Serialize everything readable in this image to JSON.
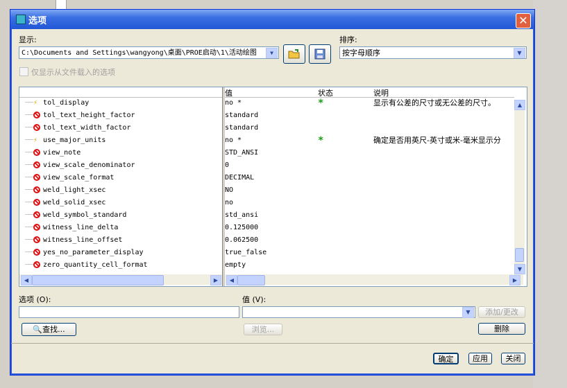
{
  "dialog": {
    "title": "选项",
    "close_glyph": "✕"
  },
  "display": {
    "label": "显示:",
    "path": "C:\\Documents and Settings\\wangyong\\桌面\\PROE启动\\1\\活动绘图",
    "open_icon": "folder-open-icon",
    "save_icon": "save-config-icon"
  },
  "sort": {
    "label": "排序:",
    "value": "按字母顺序"
  },
  "filter_checkbox": {
    "label": "仅显示从文件载入的选项",
    "checked": false
  },
  "table": {
    "headers": [
      "值",
      "状态",
      "说明"
    ],
    "rows": [
      {
        "icon": "bolt",
        "name": "tol_display",
        "value": "no *",
        "status": "*",
        "desc": "显示有公差的尺寸或无公差的尺寸。"
      },
      {
        "icon": "ban",
        "name": "tol_text_height_factor",
        "value": "standard",
        "status": "",
        "desc": ""
      },
      {
        "icon": "ban",
        "name": "tol_text_width_factor",
        "value": "standard",
        "status": "",
        "desc": ""
      },
      {
        "icon": "bolt",
        "name": "use_major_units",
        "value": "no *",
        "status": "*",
        "desc": "确定是否用英尺-英寸或米-毫米显示分"
      },
      {
        "icon": "ban",
        "name": "view_note",
        "value": "STD_ANSI",
        "status": "",
        "desc": ""
      },
      {
        "icon": "ban",
        "name": "view_scale_denominator",
        "value": "0",
        "status": "",
        "desc": ""
      },
      {
        "icon": "ban",
        "name": "view_scale_format",
        "value": "DECIMAL",
        "status": "",
        "desc": ""
      },
      {
        "icon": "ban",
        "name": "weld_light_xsec",
        "value": "NO",
        "status": "",
        "desc": ""
      },
      {
        "icon": "ban",
        "name": "weld_solid_xsec",
        "value": "no",
        "status": "",
        "desc": ""
      },
      {
        "icon": "ban",
        "name": "weld_symbol_standard",
        "value": "std_ansi",
        "status": "",
        "desc": ""
      },
      {
        "icon": "ban",
        "name": "witness_line_delta",
        "value": "0.125000",
        "status": "",
        "desc": ""
      },
      {
        "icon": "ban",
        "name": "witness_line_offset",
        "value": "0.062500",
        "status": "",
        "desc": ""
      },
      {
        "icon": "ban",
        "name": "yes_no_parameter_display",
        "value": "true_false",
        "status": "",
        "desc": ""
      },
      {
        "icon": "ban",
        "name": "zero_quantity_cell_format",
        "value": "empty",
        "status": "",
        "desc": ""
      }
    ]
  },
  "option_field": {
    "label": "选项 (O):",
    "value": ""
  },
  "value_field": {
    "label": "值 (V):",
    "value": ""
  },
  "buttons": {
    "add_change": "添加/更改",
    "find": "查找...",
    "browse": "浏览...",
    "delete": "删除",
    "ok": "确定",
    "apply": "应用",
    "close": "关闭"
  },
  "colors": {
    "title_bar": "#2257d6",
    "dialog_bg": "#ece9d8",
    "status_star": "#1a9e1a",
    "ban_icon": "#dd1111"
  }
}
